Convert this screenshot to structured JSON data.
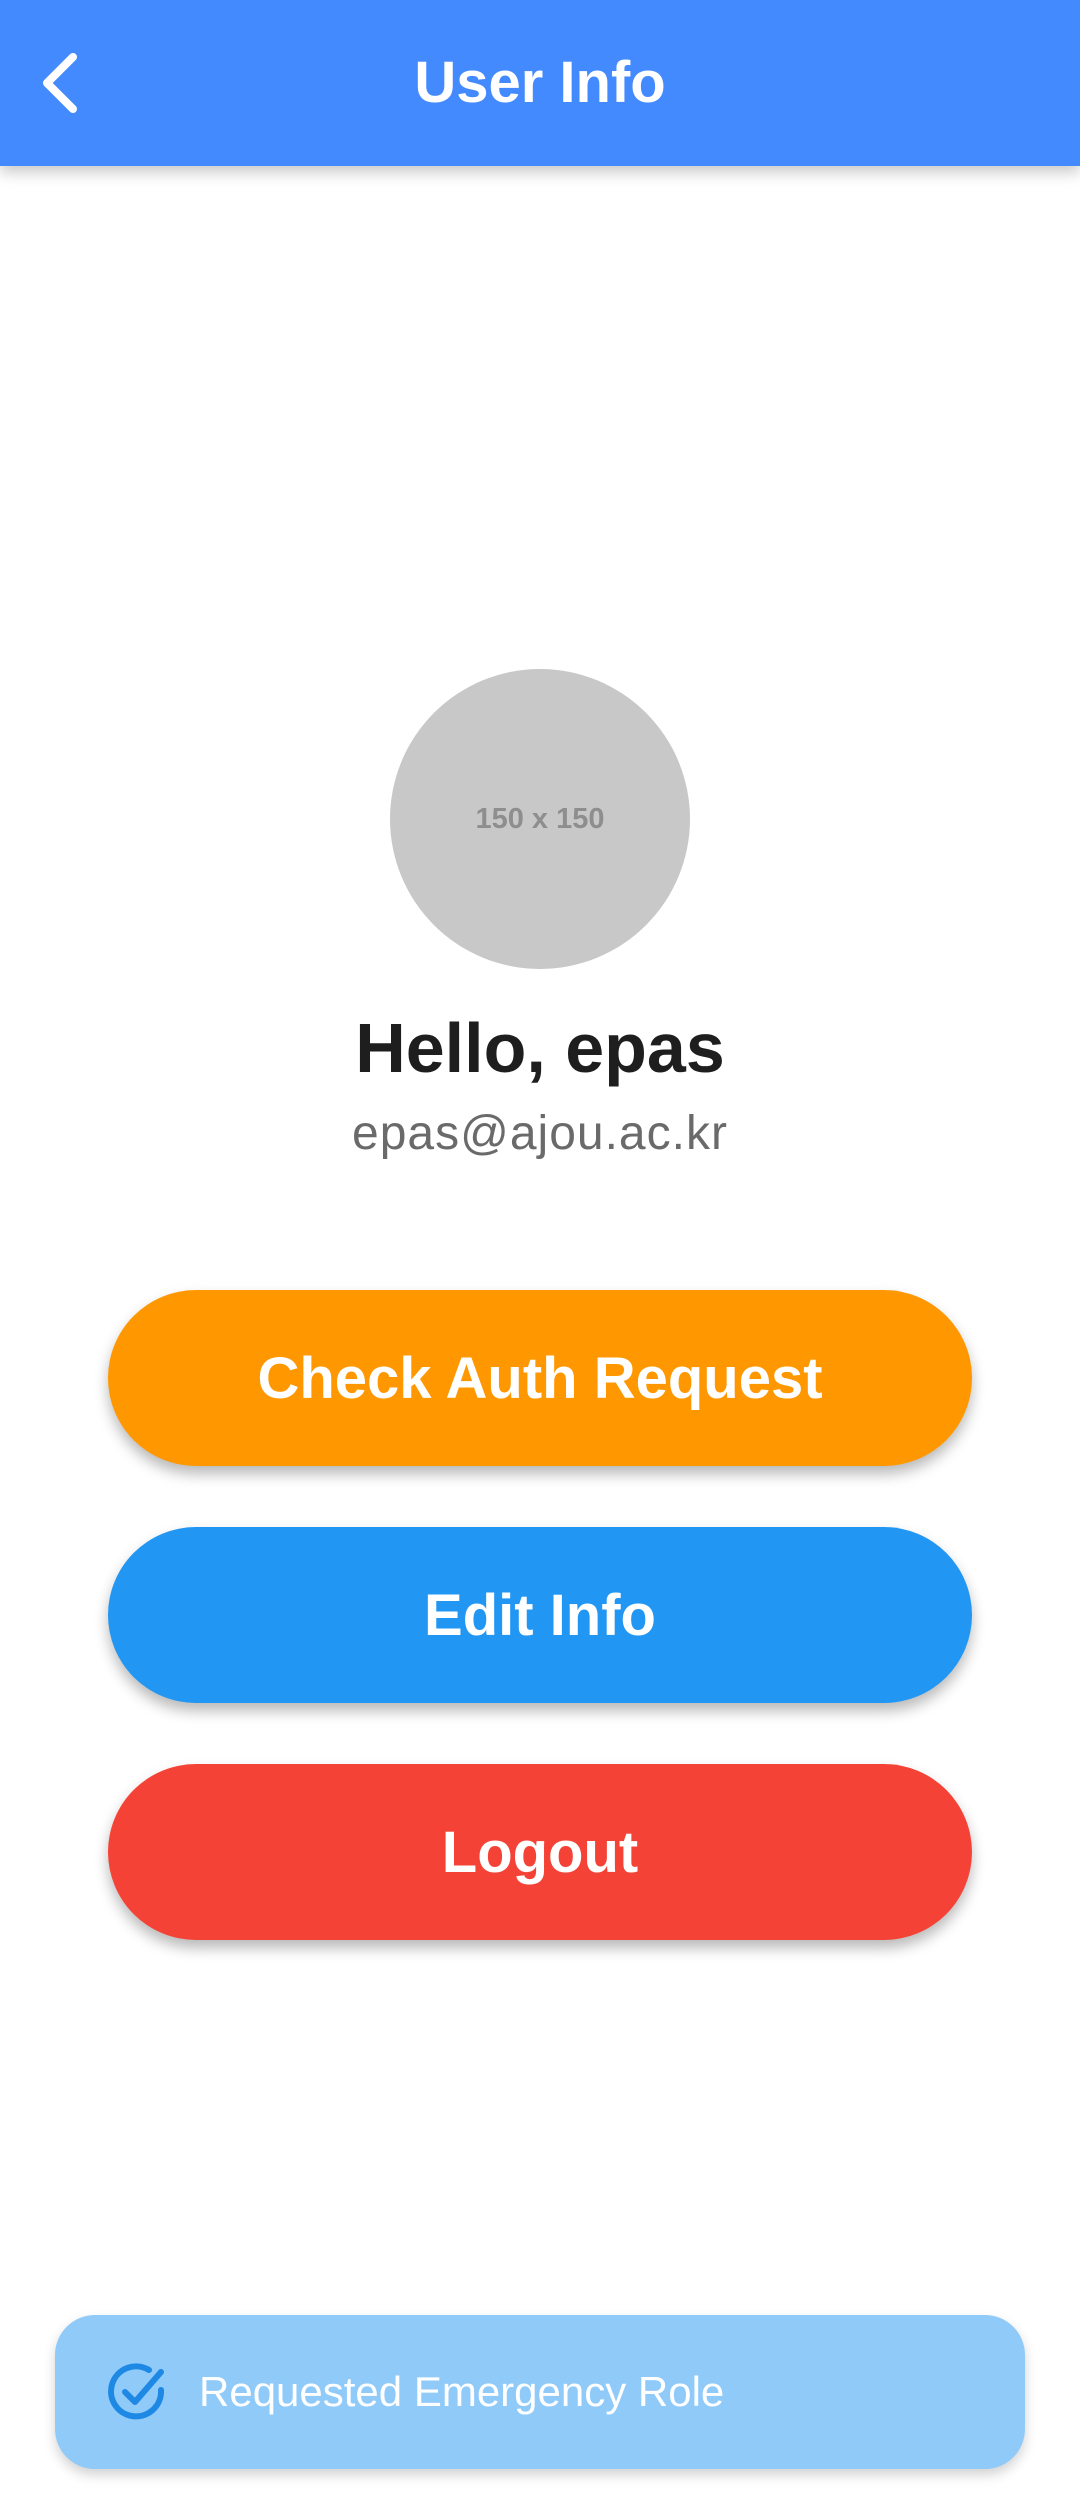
{
  "appbar": {
    "title": "User Info",
    "back_icon": "chevron-left-icon",
    "color": "#448AFF"
  },
  "profile": {
    "avatar_placeholder": "150 x 150",
    "greeting": "Hello, epas",
    "email": "epas@ajou.ac.kr"
  },
  "actions": {
    "check_auth_label": "Check Auth Request",
    "edit_info_label": "Edit Info",
    "logout_label": "Logout",
    "colors": {
      "check_auth": "#FF9800",
      "edit_info": "#2196F3",
      "logout": "#F44336"
    }
  },
  "snackbar": {
    "message": "Requested Emergency Role",
    "icon": "check-circle-icon",
    "color": "#90CAF9"
  }
}
